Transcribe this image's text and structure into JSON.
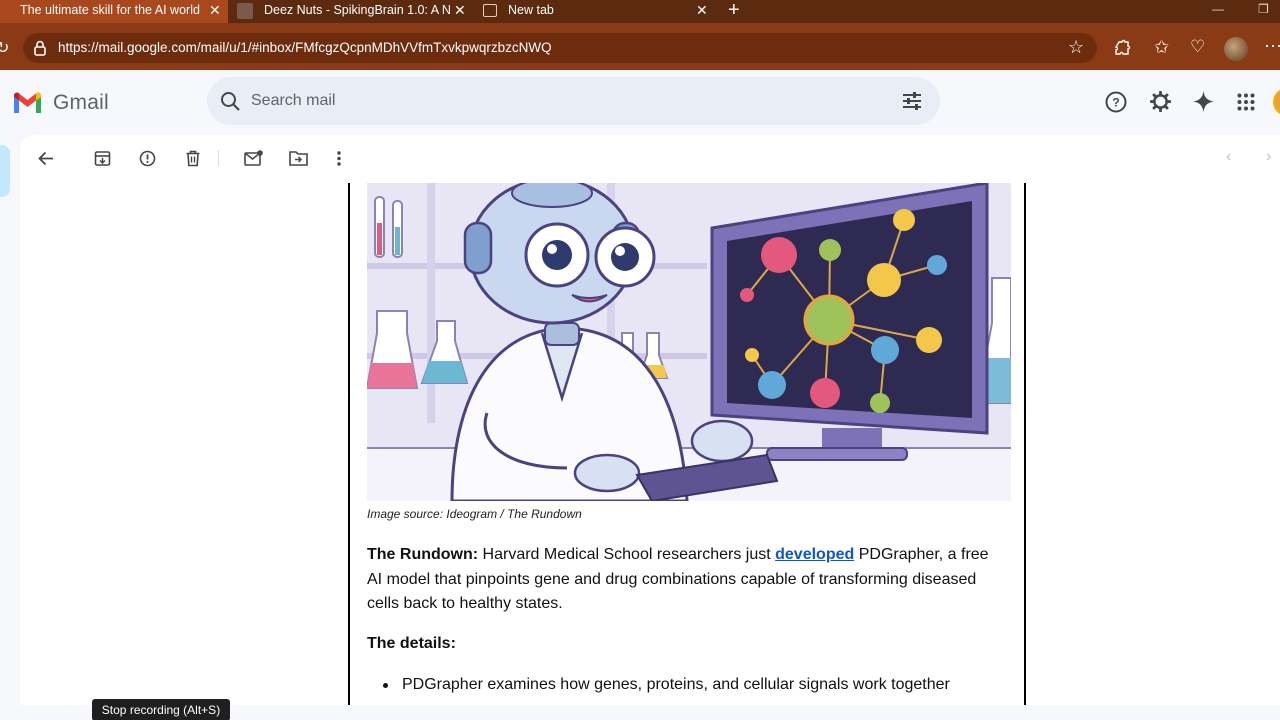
{
  "browser": {
    "tabs": [
      {
        "label": "The ultimate skill for the AI world",
        "active": true
      },
      {
        "label": "Deez Nuts - SpikingBrain 1.0: A N",
        "active": false
      },
      {
        "label": "New tab",
        "active": false
      }
    ],
    "new_tab_label": "+",
    "url": "https://mail.google.com/mail/u/1/#inbox/FMfcgzQcpnMDhVVfmTxvkpwqrzbzcNWQ",
    "colors": {
      "tabbar": "#5c2a0e",
      "active_tab": "#a8481c",
      "addressbar": "#8a3a14"
    }
  },
  "gmail": {
    "wordmark": "Gmail",
    "search_placeholder": "Search mail"
  },
  "toolbar": {
    "icons": [
      "back-arrow-icon",
      "archive-icon",
      "report-spam-icon",
      "delete-icon",
      "mark-unread-icon",
      "move-to-icon",
      "more-vert-icon",
      "prev-icon",
      "next-icon"
    ]
  },
  "email": {
    "image_caption": "Image source: Ideogram / The Rundown",
    "rundown_label": "The Rundown:",
    "rundown_text_before": "Harvard Medical School researchers just",
    "rundown_link": "developed",
    "rundown_text_after": "PDGrapher, a free AI model that pinpoints gene and drug combinations capable of transforming diseased cells back to healthy states.",
    "details_heading": "The details:",
    "bullet_1": "PDGrapher examines how genes, proteins, and cellular signals work together"
  },
  "overlay": {
    "recording_toast": "Stop recording (Alt+S)"
  }
}
